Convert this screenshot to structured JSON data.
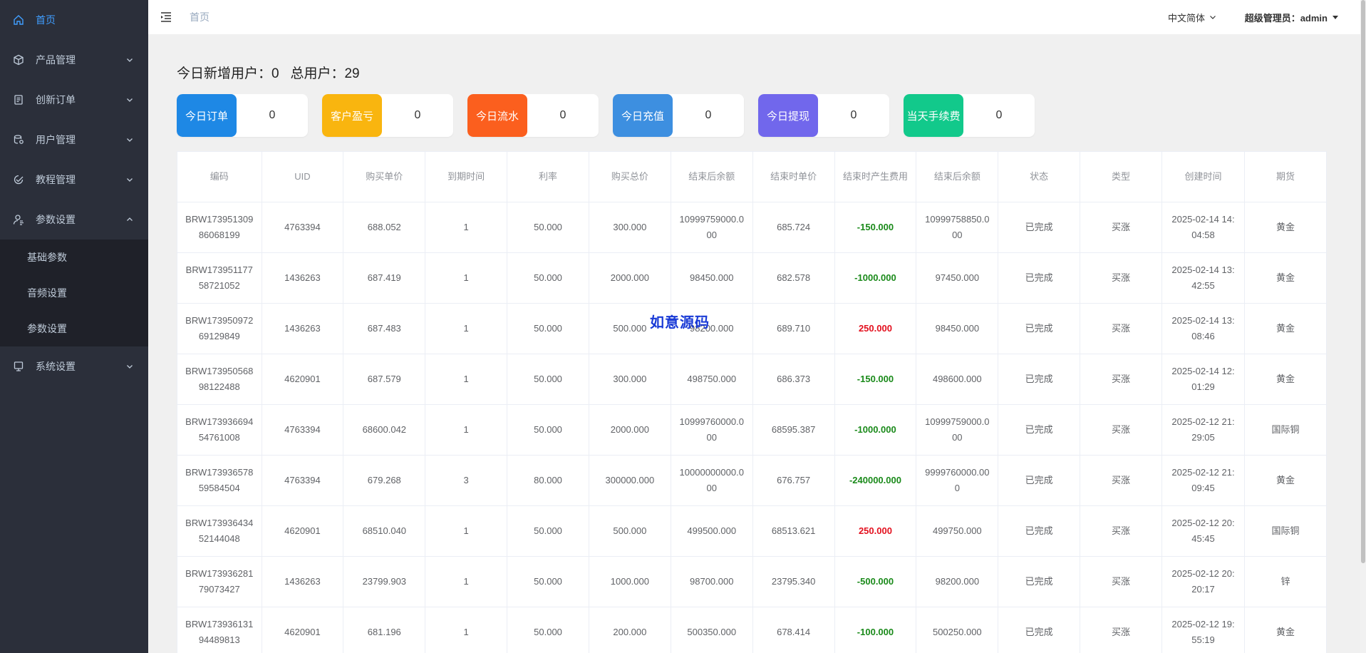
{
  "sidebar": {
    "items": [
      {
        "label": "首页",
        "icon": "home-icon",
        "active": true
      },
      {
        "label": "产品管理",
        "icon": "cube-icon"
      },
      {
        "label": "创新订单",
        "icon": "order-icon"
      },
      {
        "label": "用户管理",
        "icon": "user-db-icon"
      },
      {
        "label": "教程管理",
        "icon": "check-circle-icon"
      },
      {
        "label": "参数设置",
        "icon": "user-settings-icon",
        "expanded": true
      },
      {
        "label": "系统设置",
        "icon": "monitor-icon"
      }
    ],
    "sub_items": [
      "基础参数",
      "音频设置",
      "参数设置"
    ]
  },
  "header": {
    "breadcrumb": "首页",
    "language": "中文简体",
    "user": "超级管理员：admin"
  },
  "stats": {
    "new_users_label": "今日新增用户：",
    "new_users_value": "0",
    "total_users_label": "总用户：",
    "total_users_value": "29"
  },
  "cards": [
    {
      "label": "今日订单",
      "value": "0",
      "color": "#1e88e5"
    },
    {
      "label": "客户盈亏",
      "value": "0",
      "color": "#f9b50f"
    },
    {
      "label": "今日流水",
      "value": "0",
      "color": "#fb5f1e"
    },
    {
      "label": "今日充值",
      "value": "0",
      "color": "#3d8fe0"
    },
    {
      "label": "今日提现",
      "value": "0",
      "color": "#7167ec"
    },
    {
      "label": "当天手续费",
      "value": "0",
      "color": "#12c98b"
    }
  ],
  "table": {
    "columns": [
      "编码",
      "UID",
      "购买单价",
      "到期时间",
      "利率",
      "购买总价",
      "结束后余额",
      "结束时单价",
      "结束时产生费用",
      "结束后余额",
      "状态",
      "类型",
      "创建时间",
      "期货"
    ],
    "rows": [
      [
        "BRW17395130986068199",
        "4763394",
        "688.052",
        "1",
        "50.000",
        "300.000",
        "10999759000.000",
        "685.724",
        "-150.000",
        "10999758850.000",
        "已完成",
        "买涨",
        "2025-02-14 14:04:58",
        "黄金"
      ],
      [
        "BRW17395117758721052",
        "1436263",
        "687.419",
        "1",
        "50.000",
        "2000.000",
        "98450.000",
        "682.578",
        "-1000.000",
        "97450.000",
        "已完成",
        "买涨",
        "2025-02-14 13:42:55",
        "黄金"
      ],
      [
        "BRW17395097269129849",
        "1436263",
        "687.483",
        "1",
        "50.000",
        "500.000",
        "98200.000",
        "689.710",
        "250.000",
        "98450.000",
        "已完成",
        "买涨",
        "2025-02-14 13:08:46",
        "黄金"
      ],
      [
        "BRW17395056898122488",
        "4620901",
        "687.579",
        "1",
        "50.000",
        "300.000",
        "498750.000",
        "686.373",
        "-150.000",
        "498600.000",
        "已完成",
        "买涨",
        "2025-02-14 12:01:29",
        "黄金"
      ],
      [
        "BRW17393669454761008",
        "4763394",
        "68600.042",
        "1",
        "50.000",
        "2000.000",
        "10999760000.000",
        "68595.387",
        "-1000.000",
        "10999759000.000",
        "已完成",
        "买涨",
        "2025-02-12 21:29:05",
        "国际铜"
      ],
      [
        "BRW17393657859584504",
        "4763394",
        "679.268",
        "3",
        "80.000",
        "300000.000",
        "10000000000.000",
        "676.757",
        "-240000.000",
        "9999760000.000",
        "已完成",
        "买涨",
        "2025-02-12 21:09:45",
        "黄金"
      ],
      [
        "BRW17393643452144048",
        "4620901",
        "68510.040",
        "1",
        "50.000",
        "500.000",
        "499500.000",
        "68513.621",
        "250.000",
        "499750.000",
        "已完成",
        "买涨",
        "2025-02-12 20:45:45",
        "国际铜"
      ],
      [
        "BRW17393628179073427",
        "1436263",
        "23799.903",
        "1",
        "50.000",
        "1000.000",
        "98700.000",
        "23795.340",
        "-500.000",
        "98200.000",
        "已完成",
        "买涨",
        "2025-02-12 20:20:17",
        "锌"
      ],
      [
        "BRW17393613194489813",
        "4620901",
        "681.196",
        "1",
        "50.000",
        "200.000",
        "500350.000",
        "678.414",
        "-100.000",
        "500250.000",
        "已完成",
        "买涨",
        "2025-02-12 19:55:19",
        "黄金"
      ]
    ]
  },
  "watermark": "如意源码",
  "colors": {
    "sidebar_bg": "#2b2f3a",
    "active": "#409eff",
    "negative": "#1a8a1a",
    "positive": "#e3101e"
  }
}
